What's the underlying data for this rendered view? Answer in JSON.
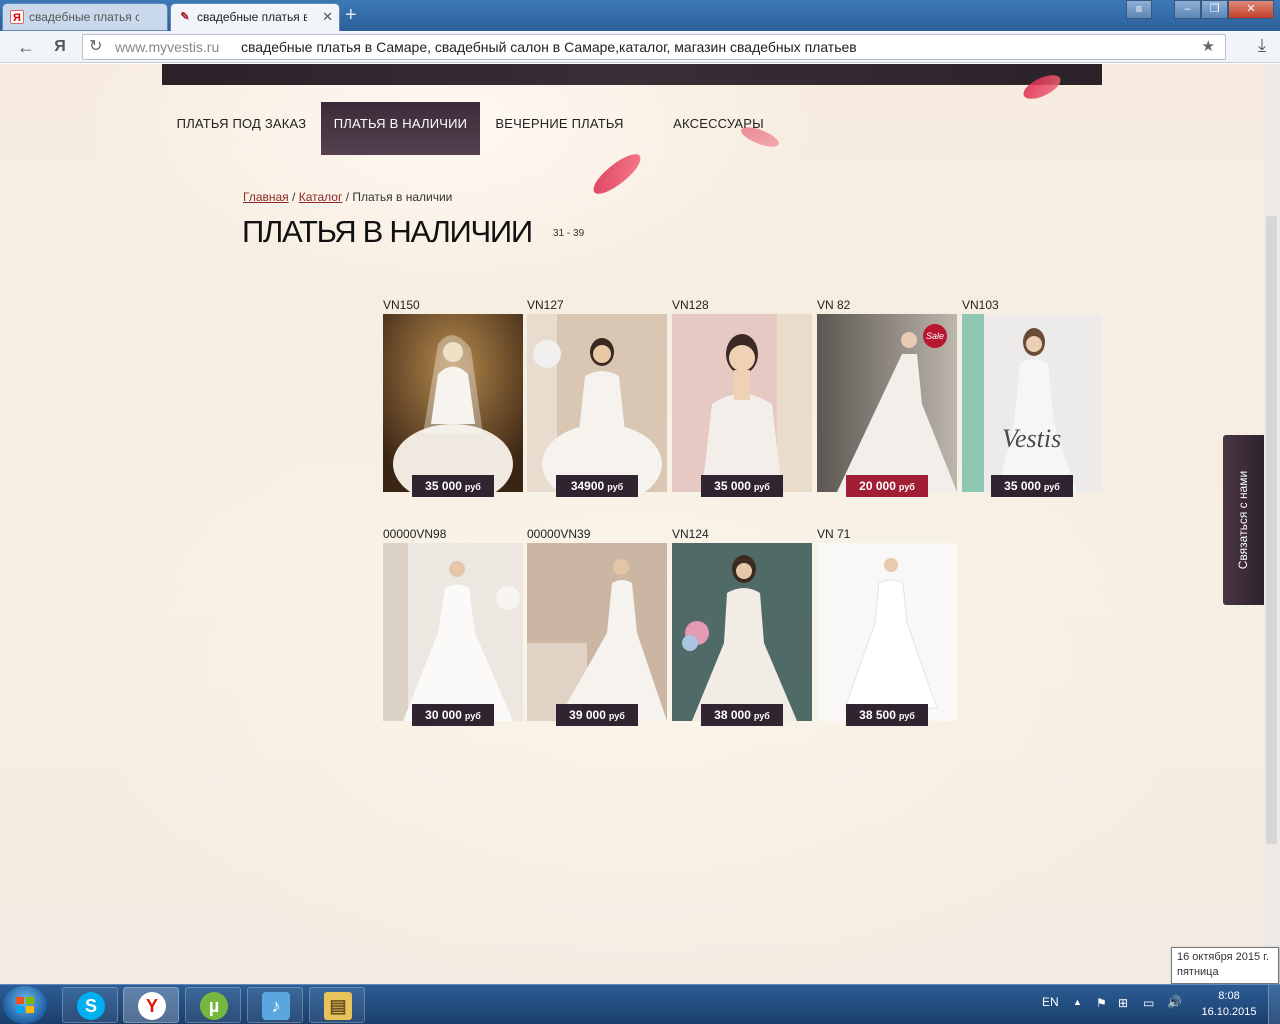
{
  "browser": {
    "tabs": [
      {
        "label": "свадебные платья сам",
        "favicon": "Я",
        "active": false
      },
      {
        "label": "свадебные платья в С",
        "favicon": "✎",
        "active": true
      }
    ],
    "new_tab_icon": "+",
    "url_domain": "www.myvestis.ru",
    "page_title": "свадебные платья в Самаре, свадебный салон в Самаре,каталог, магазин свадебных платьев",
    "yandex_glyph": "Я"
  },
  "site": {
    "nav": [
      {
        "label": "ПЛАТЬЯ ПОД ЗАКАЗ",
        "active": false
      },
      {
        "label": "ПЛАТЬЯ В НАЛИЧИИ",
        "active": true
      },
      {
        "label": "ВЕЧЕРНИЕ ПЛАТЬЯ",
        "active": false
      },
      {
        "label": "АКСЕССУАРЫ",
        "active": false
      }
    ],
    "breadcrumb": {
      "home": "Главная",
      "sep1": "/",
      "catalog": "Каталог",
      "sep2": "/",
      "current": "Платья в наличии"
    },
    "title": "ПЛАТЬЯ В НАЛИЧИИ",
    "page_count": "31 - 39",
    "currency": "руб",
    "products": [
      {
        "code": "VN150",
        "price": "35 000",
        "sale": false
      },
      {
        "code": "VN127",
        "price": "34900",
        "sale": false
      },
      {
        "code": "VN128",
        "price": "35 000",
        "sale": false
      },
      {
        "code": "VN 82",
        "price": "20 000",
        "sale": true,
        "badge": "Sale"
      },
      {
        "code": "VN103",
        "price": "35 000",
        "sale": false,
        "watermark": "Vestis"
      },
      {
        "code": "00000VN98",
        "price": "30 000",
        "sale": false
      },
      {
        "code": "00000VN39",
        "price": "39 000",
        "sale": false
      },
      {
        "code": "VN124",
        "price": "38 000",
        "sale": false
      },
      {
        "code": "VN 71",
        "price": "38 500",
        "sale": false
      }
    ],
    "contact_tab": "Связаться с нами"
  },
  "tooltip": {
    "line1": "16 октября 2015 г.",
    "line2": "пятница"
  },
  "taskbar": {
    "lang": "EN",
    "time": "8:08",
    "date": "16.10.2015",
    "apps": [
      "skype-icon",
      "yandex-browser-icon",
      "utorrent-icon",
      "music-icon",
      "file-explorer-icon"
    ]
  },
  "colors": {
    "nav_active": "#3b2b38",
    "price_bg": "#2f2430",
    "sale_bg": "#a11f35",
    "link": "#8b2a2a"
  }
}
